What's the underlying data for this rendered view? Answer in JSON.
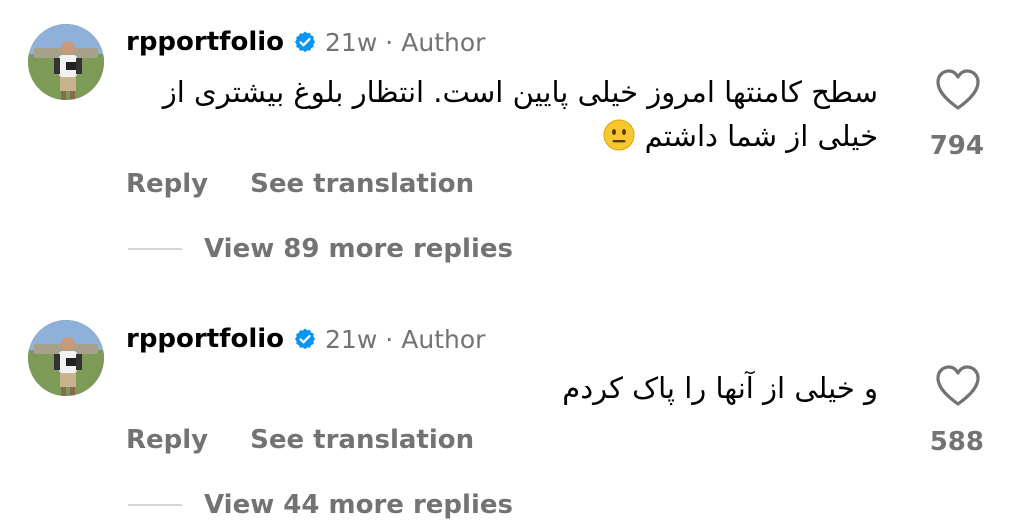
{
  "comments": [
    {
      "username": "rpportfolio",
      "time": "21w",
      "separator": "·",
      "role": "Author",
      "text": "سطح کامنتها امروز خیلی پایین است. انتظار بلوغ بیشتری از خیلی از شما داشتم",
      "emoji": "neutral-face-emoji",
      "reply_label": "Reply",
      "translate_label": "See translation",
      "like_count": "794",
      "view_replies_label": "View 89 more replies"
    },
    {
      "username": "rpportfolio",
      "time": "21w",
      "separator": "·",
      "role": "Author",
      "text": "و خیلی از آنها را پاک کردم",
      "reply_label": "Reply",
      "translate_label": "See translation",
      "like_count": "588",
      "view_replies_label": "View 44 more replies"
    }
  ],
  "icons": {
    "verified": "verified-badge-icon",
    "like": "heart-icon"
  },
  "colors": {
    "verified_blue": "#0095f6",
    "secondary_text": "#737373",
    "primary_text": "#000000",
    "divider": "#d6d6d6"
  }
}
